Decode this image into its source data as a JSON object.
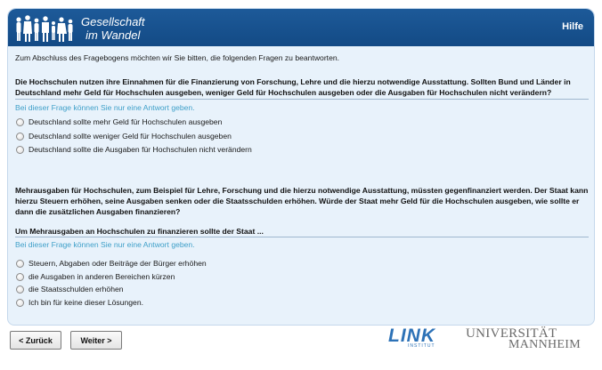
{
  "header": {
    "logo_line1": "Gesellschaft",
    "logo_line2": "im Wandel",
    "help_label": "Hilfe",
    "colors": {
      "bar": "#1a5594",
      "panel": "#e8f2fb",
      "hint": "#3fa0c9"
    }
  },
  "intro": "Zum Abschluss des Fragebogens möchten wir Sie bitten, die folgenden Fragen zu beantworten.",
  "question1": {
    "title": "Die Hochschulen nutzen ihre Einnahmen für die Finanzierung von Forschung, Lehre und die hierzu notwendige Ausstattung. Sollten Bund und Länder in Deutschland mehr Geld für Hochschulen ausgeben, weniger Geld für Hochschulen ausgeben oder die Ausgaben für Hochschulen nicht verändern?",
    "hint": "Bei dieser Frage können Sie nur eine Antwort geben.",
    "options": [
      "Deutschland sollte mehr Geld für Hochschulen ausgeben",
      "Deutschland sollte weniger Geld für Hochschulen ausgeben",
      "Deutschland sollte die Ausgaben für Hochschulen nicht verändern"
    ]
  },
  "question2": {
    "title": "Mehrausgaben für Hochschulen, zum Beispiel für Lehre, Forschung und die hierzu notwendige Ausstattung, müssten gegenfinanziert werden. Der Staat kann hierzu Steuern erhöhen, seine Ausgaben senken oder die Staatsschulden erhöhen. Würde der Staat mehr Geld für die Hochschulen ausgeben, wie sollte er dann die zusätzlichen Ausgaben finanzieren?",
    "subtitle": "Um Mehrausgaben an Hochschulen zu finanzieren sollte der Staat ...",
    "hint": "Bei dieser Frage können Sie nur eine Antwort geben.",
    "options": [
      "Steuern, Abgaben oder Beiträge der Bürger erhöhen",
      "die Ausgaben in anderen Bereichen kürzen",
      "die Staatsschulden erhöhen",
      "Ich bin für keine dieser Lösungen."
    ]
  },
  "nav": {
    "back_label": "< Zurück",
    "next_label": "Weiter >"
  },
  "footer": {
    "link_logo": "LINK",
    "link_sub": "INSTITUT",
    "uni_line1": "UNIVERSITÄT",
    "uni_line2": "MANNHEIM"
  }
}
